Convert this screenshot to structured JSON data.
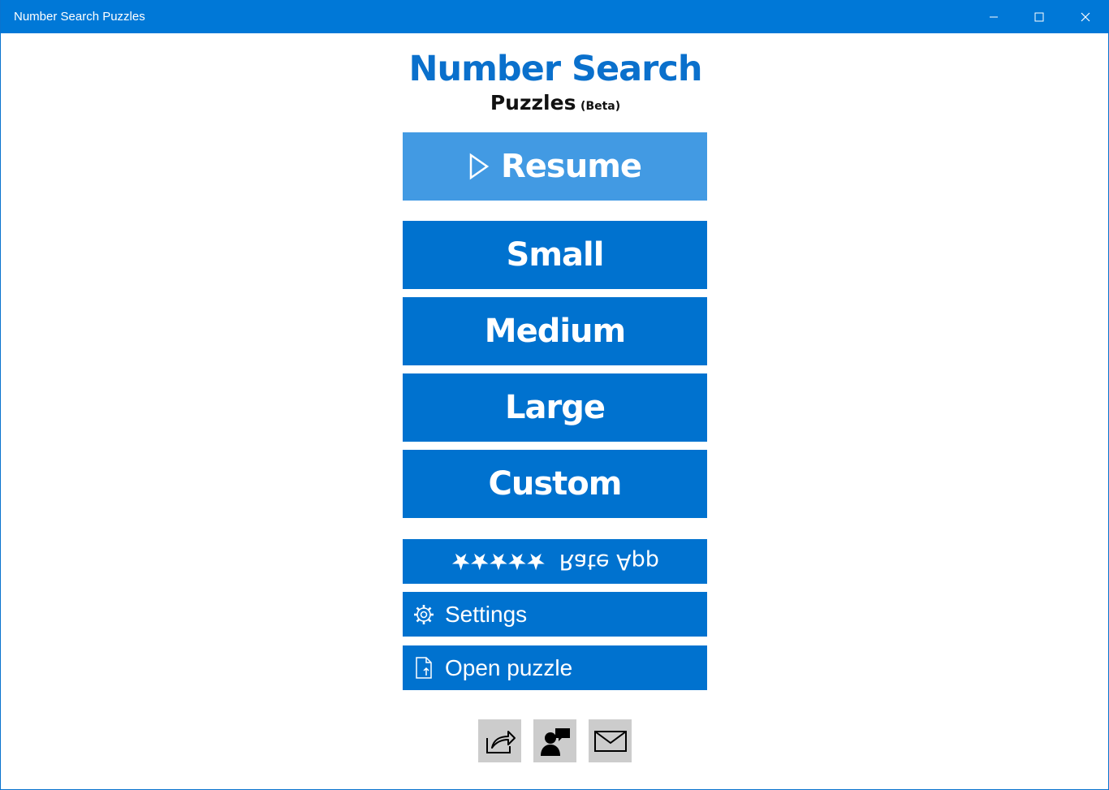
{
  "window": {
    "title": "Number Search Puzzles",
    "controls": [
      "minimize-icon",
      "maximize-icon",
      "close-icon"
    ]
  },
  "logo": {
    "line1": "Number Search",
    "line2": "Puzzles",
    "badge": "(Beta)"
  },
  "menu": {
    "resume": "Resume",
    "small": "Small",
    "medium": "Medium",
    "large": "Large",
    "custom": "Custom"
  },
  "actions": {
    "rate_stars": "★★★★★",
    "rate_label": "Rate App",
    "settings": "Settings",
    "open_puzzle": "Open puzzle"
  },
  "bottom_icons": [
    "share-icon",
    "feedback-icon",
    "mail-icon"
  ],
  "colors": {
    "titlebar": "#0078d7",
    "button": "#0072cf",
    "resume_button": "#429ae3",
    "icon_button": "#cccccc"
  }
}
